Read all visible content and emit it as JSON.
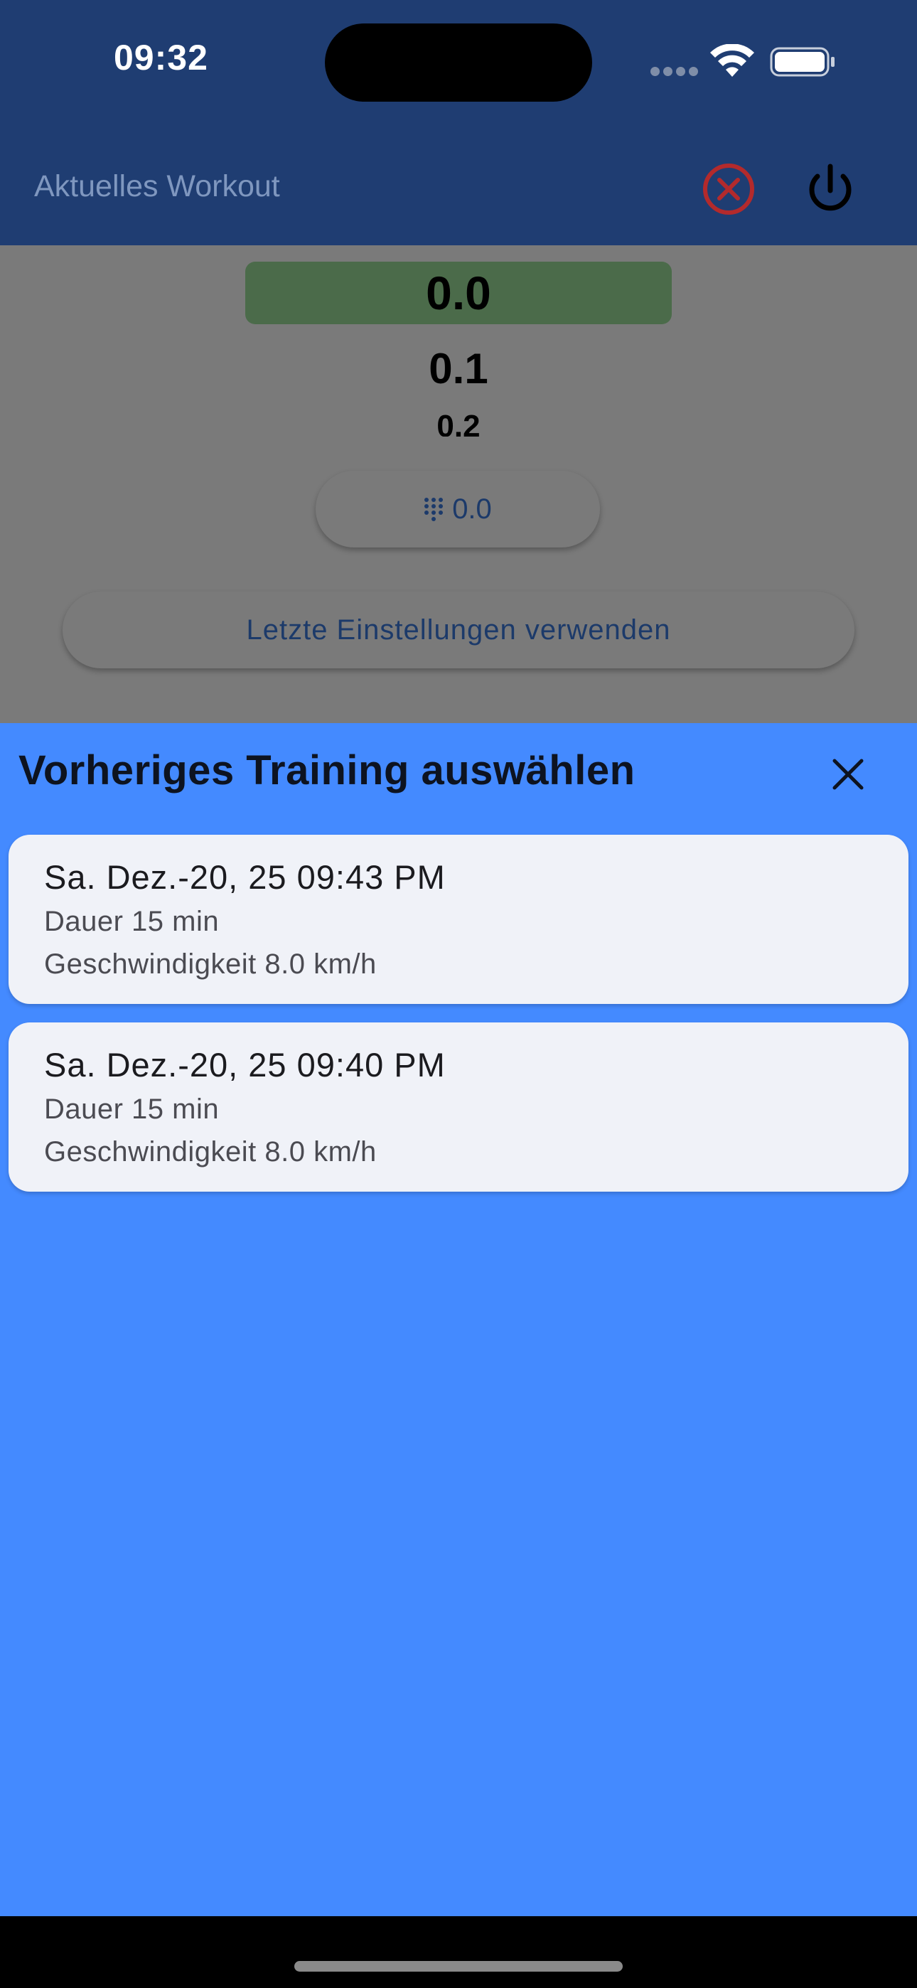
{
  "status_bar": {
    "time": "09:32"
  },
  "app_bar": {
    "title": "Aktuelles Workout",
    "cancel_icon": "cancel-circle-icon",
    "power_icon": "power-icon",
    "cancel_color": "#c0282a"
  },
  "speed_picker": {
    "selected": "0.0",
    "next": "0.1",
    "next2": "0.2",
    "selected_bg": "#4b6b4a"
  },
  "keypad_button": {
    "label": "0.0",
    "icon": "dialpad-icon"
  },
  "last_settings_button": {
    "label": "Letzte Einstellungen verwenden"
  },
  "sheet": {
    "title": "Vorheriges Training auswählen",
    "close_icon": "close-icon",
    "background": "#448aff",
    "items": [
      {
        "title": "Sa. Dez.-20, 25 09:43 PM",
        "duration": "Dauer 15 min",
        "speed": "Geschwindigkeit 8.0 km/h"
      },
      {
        "title": "Sa. Dez.-20, 25 09:40 PM",
        "duration": "Dauer 15 min",
        "speed": "Geschwindigkeit 8.0 km/h"
      }
    ]
  }
}
